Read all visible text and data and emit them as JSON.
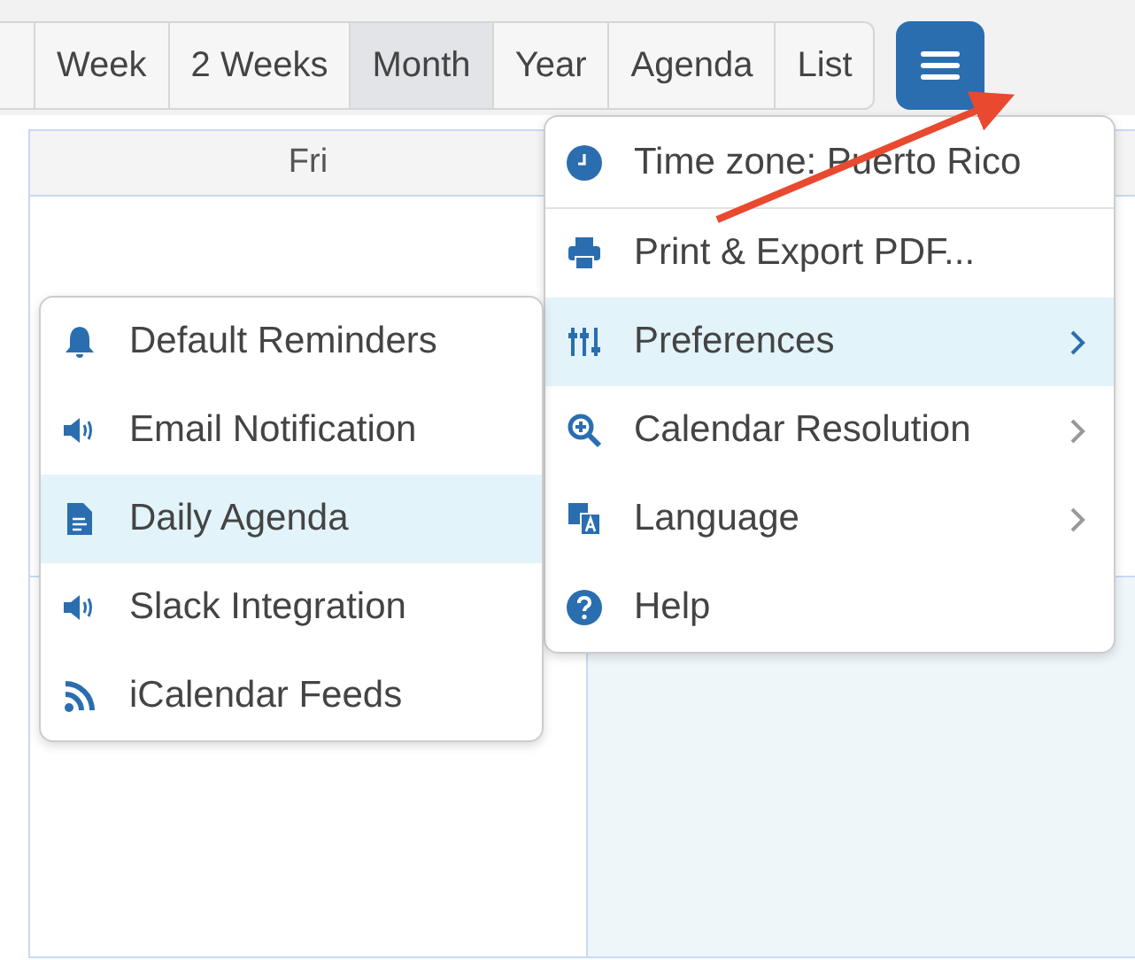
{
  "toolbar": {
    "tabs": [
      {
        "label": "Week",
        "selected": false
      },
      {
        "label": "2 Weeks",
        "selected": false
      },
      {
        "label": "Month",
        "selected": true
      },
      {
        "label": "Year",
        "selected": false
      },
      {
        "label": "Agenda",
        "selected": false
      },
      {
        "label": "List",
        "selected": false
      }
    ]
  },
  "calendar": {
    "header": "Fri"
  },
  "menu": {
    "items": [
      {
        "label": "Time zone: Puerto Rico",
        "has_submenu": false,
        "selected": false
      },
      {
        "label": "Print & Export PDF...",
        "has_submenu": false,
        "selected": false
      },
      {
        "label": "Preferences",
        "has_submenu": true,
        "selected": true
      },
      {
        "label": "Calendar Resolution",
        "has_submenu": true,
        "selected": false
      },
      {
        "label": "Language",
        "has_submenu": true,
        "selected": false
      },
      {
        "label": "Help",
        "has_submenu": false,
        "selected": false
      }
    ]
  },
  "submenu": {
    "items": [
      {
        "label": "Default Reminders",
        "selected": false
      },
      {
        "label": "Email Notification",
        "selected": false
      },
      {
        "label": "Daily Agenda",
        "selected": true
      },
      {
        "label": "Slack Integration",
        "selected": false
      },
      {
        "label": "iCalendar Feeds",
        "selected": false
      }
    ]
  }
}
